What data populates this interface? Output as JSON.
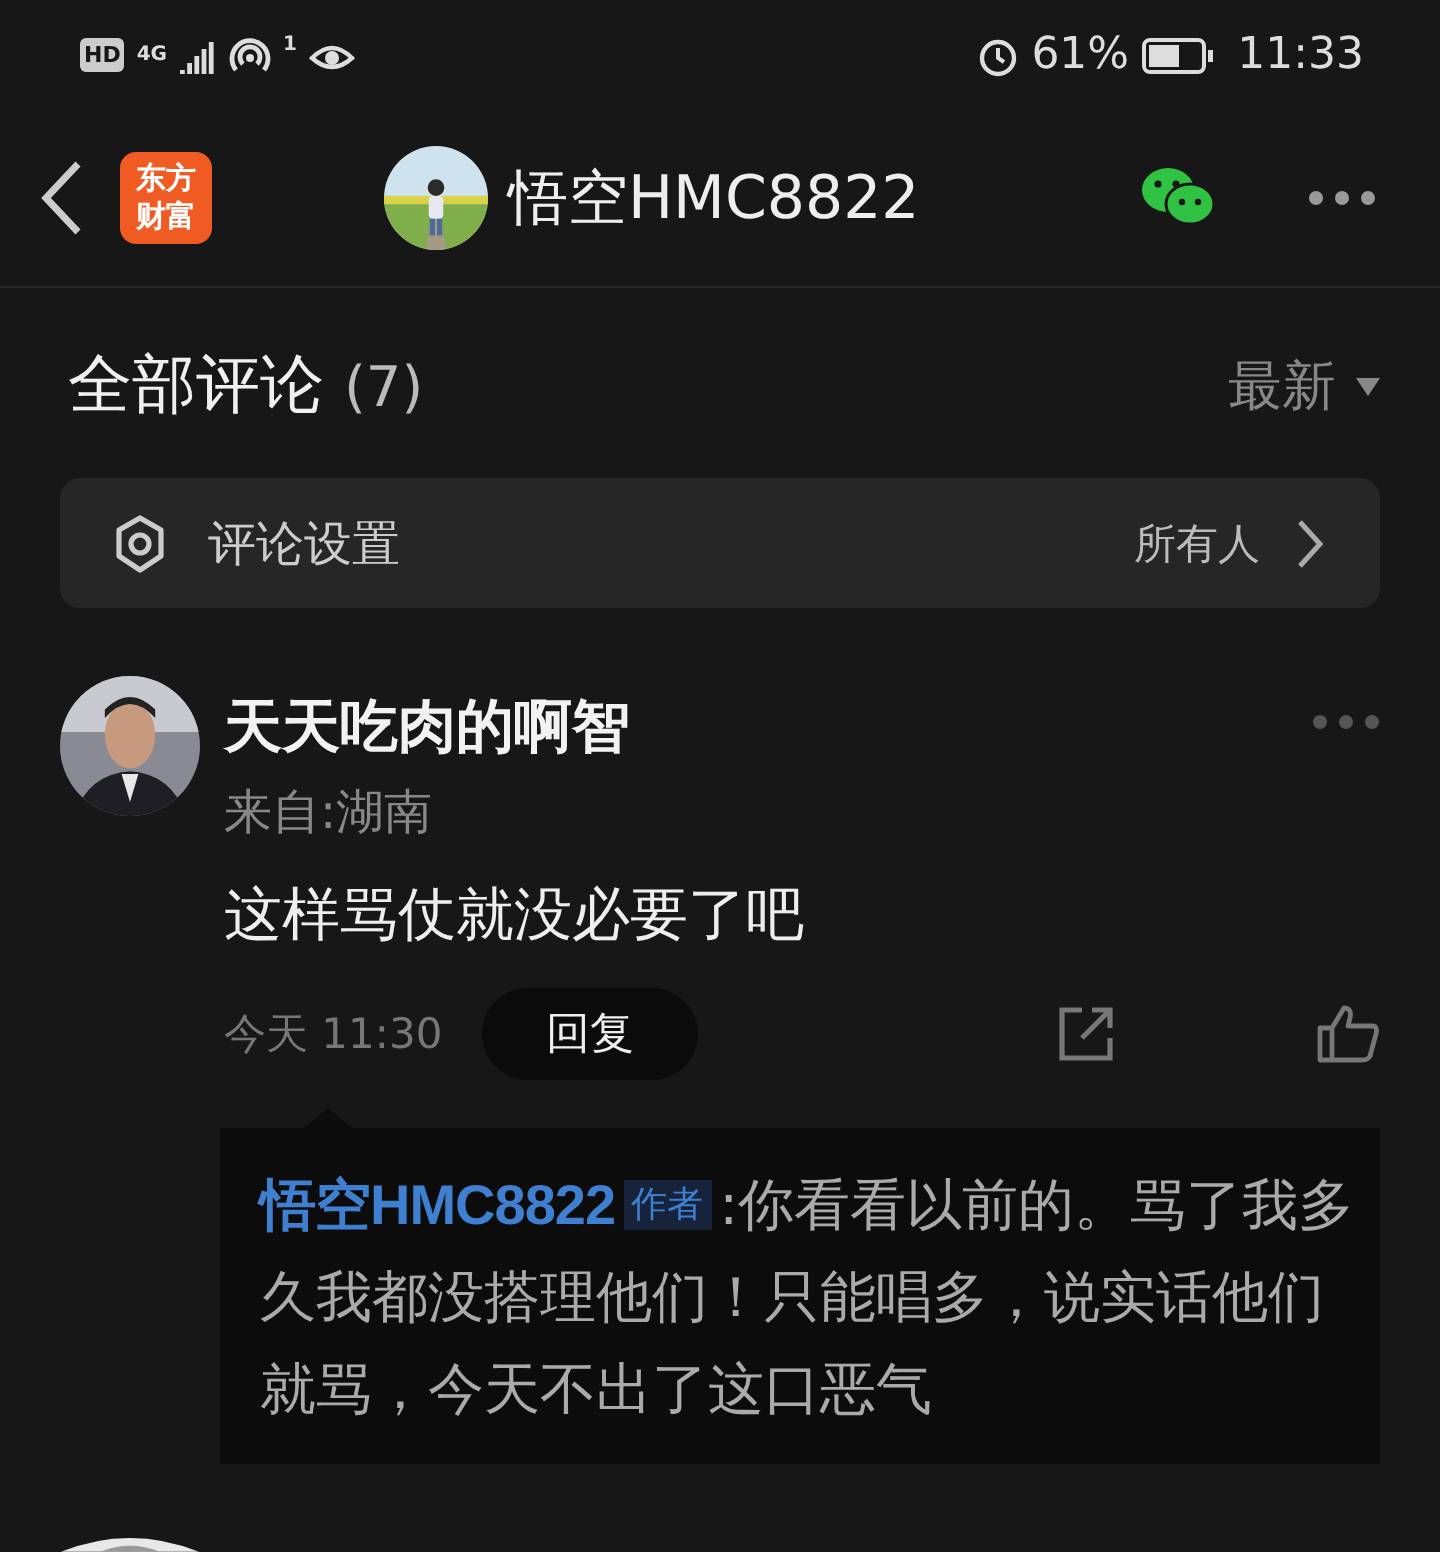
{
  "status_bar": {
    "hd": "HD",
    "network": "4G",
    "hotspot_count": "1",
    "battery_percent": "61%",
    "time": "11:33"
  },
  "header": {
    "app_logo": "东方财富",
    "title": "悟空HMC8822"
  },
  "comments_header": {
    "title": "全部评论",
    "count": "(7)",
    "sort": "最新"
  },
  "comment_settings": {
    "label": "评论设置",
    "value": "所有人"
  },
  "comments": [
    {
      "name": "天天吃肉的啊智",
      "location": "来自:湖南",
      "text": "这样骂仗就没必要了吧",
      "time": "今天 11:30",
      "reply_button": "回复",
      "replies": [
        {
          "author": "悟空HMC8822",
          "badge": "作者",
          "text": ":你看看以前的。骂了我多久我都没搭理他们！只能唱多，说实话他们就骂，今天不出了这口恶气"
        }
      ]
    }
  ]
}
